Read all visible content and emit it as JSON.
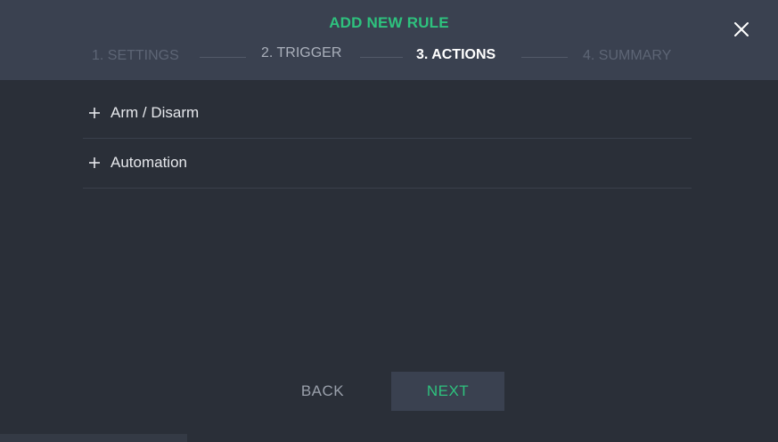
{
  "dialog": {
    "title": "ADD NEW RULE",
    "close_icon": "close-icon"
  },
  "steps": [
    {
      "label": "1. SETTINGS",
      "state": "done"
    },
    {
      "label": "2. TRIGGER",
      "state": "visited"
    },
    {
      "label": "3. ACTIONS",
      "state": "active"
    },
    {
      "label": "4. SUMMARY",
      "state": "pending"
    }
  ],
  "actions": [
    {
      "label": "Arm / Disarm",
      "icon": "plus-icon"
    },
    {
      "label": "Automation",
      "icon": "plus-icon"
    }
  ],
  "footer": {
    "back_label": "BACK",
    "next_label": "NEXT"
  },
  "colors": {
    "accent": "#2ec27e",
    "header_bg": "#3a4150",
    "body_bg": "#2a2f38",
    "active_step": "#ffffff"
  }
}
